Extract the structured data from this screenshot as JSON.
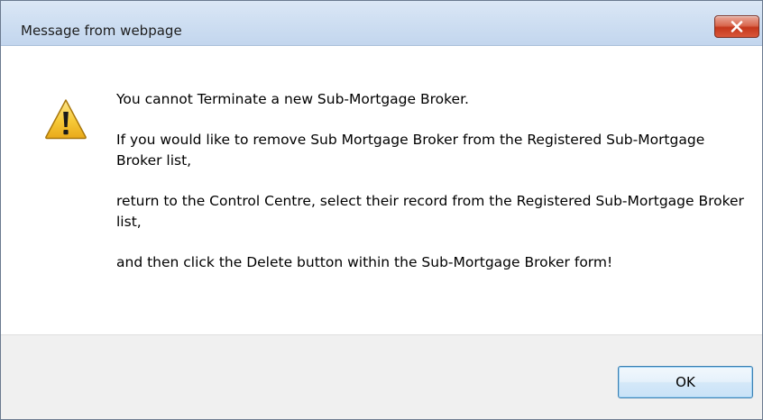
{
  "window": {
    "title": "Message from webpage",
    "close_icon": "close-icon",
    "close_color": "#c7432a"
  },
  "content": {
    "icon": "warning-icon",
    "icon_color": "#f2c230",
    "paragraphs": [
      "You cannot Terminate a new Sub-Mortgage Broker.",
      "If you would like to remove Sub Mortgage Broker from the Registered Sub-Mortgage Broker list,",
      "return to the Control Centre, select their record from the Registered Sub-Mortgage Broker list,",
      "and then click the Delete button within the Sub-Mortgage Broker form!"
    ]
  },
  "footer": {
    "ok_label": "OK"
  }
}
